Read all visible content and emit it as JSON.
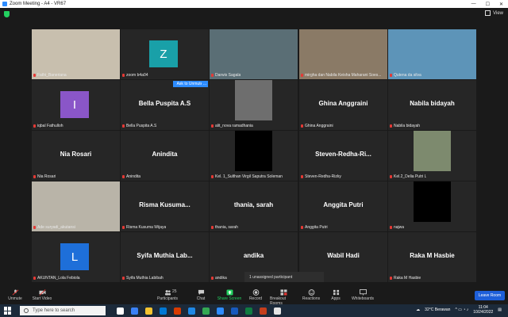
{
  "window": {
    "title": "Zoom Meeting - A4 - VR67"
  },
  "view_button": {
    "label": "View"
  },
  "participants": [
    {
      "id": "p1",
      "label": "Fathi_Baneriana",
      "type": "video",
      "bg": "#c8bfae"
    },
    {
      "id": "p2",
      "label": "zoom b4a04",
      "type": "avatar",
      "letter": "Z",
      "color": "#19a0a8"
    },
    {
      "id": "p3",
      "label": "Darwis Sagala",
      "type": "video",
      "bg": "#5a6e75",
      "active": true
    },
    {
      "id": "p4",
      "label": "mirgha dan Nabila Keisha Maharani Soes...",
      "type": "video",
      "bg": "#8a7a66"
    },
    {
      "id": "p5",
      "label": "Qutena da silva",
      "type": "video",
      "bg": "#5d94b8"
    },
    {
      "id": "p6",
      "label": "iqbal Fathulloh",
      "type": "avatar",
      "letter": "I",
      "color": "#8a56c8"
    },
    {
      "id": "p7",
      "label": "Bella Puspita A.S",
      "type": "text",
      "big": "Bella Puspita A.S"
    },
    {
      "id": "p8",
      "label": "alit_nova ramadhania",
      "type": "video",
      "bg": "#6e6e6e",
      "small": true
    },
    {
      "id": "p9",
      "label": "Ghina Anggraini",
      "type": "text",
      "big": "Ghina Anggraini"
    },
    {
      "id": "p10",
      "label": "Nabila bidayah",
      "type": "text",
      "big": "Nabila bidayah"
    },
    {
      "id": "p11",
      "label": "Nia Rosari",
      "type": "text",
      "big": "Nia Rosari"
    },
    {
      "id": "p12",
      "label": "Anindita",
      "type": "text",
      "big": "Anindita"
    },
    {
      "id": "p13",
      "label": "Kel. 1_Sulthan Virgil Saputra Soleman",
      "type": "video",
      "bg": "#000000",
      "small": true
    },
    {
      "id": "p14",
      "label": "Steven-Redha-Rizky",
      "type": "text",
      "big": "Steven-Redha-Ri..."
    },
    {
      "id": "p15",
      "label": "Kel.2_Delia Putri L",
      "type": "video",
      "bg": "#7d8a6e",
      "small": true
    },
    {
      "id": "p16",
      "label": "Ade suryadi_akutansi",
      "type": "video",
      "bg": "#b9b4a8"
    },
    {
      "id": "p17",
      "label": "Risma Kusuma Wijaya",
      "type": "text",
      "big": "Risma Kusuma..."
    },
    {
      "id": "p18",
      "label": "thania, sarah",
      "type": "text",
      "big": "thania, sarah"
    },
    {
      "id": "p19",
      "label": "Anggita Putri",
      "type": "text",
      "big": "Anggita Putri"
    },
    {
      "id": "p20",
      "label": "najwa",
      "type": "video",
      "bg": "#000000",
      "small": true
    },
    {
      "id": "p21",
      "label": "AKUNTAN_Lola Febiola",
      "type": "avatar",
      "letter": "L",
      "color": "#1e6fd9"
    },
    {
      "id": "p22",
      "label": "Syifa Muthia Labibah",
      "type": "text",
      "big": "Syifa Muthia Lab..."
    },
    {
      "id": "p23",
      "label": "andika",
      "type": "text",
      "big": "andika"
    },
    {
      "id": "p24",
      "label": "",
      "type": "text",
      "big": "Wabil Hadi"
    },
    {
      "id": "p25",
      "label": "Raka M Hasbie",
      "type": "text",
      "big": "Raka M Hasbie"
    }
  ],
  "ask_to_unmute": {
    "label": "Ask to Unmute",
    "more": "..."
  },
  "unassigned": {
    "label": "1 unassigned participant"
  },
  "toolbar": {
    "unmute": "Unmute",
    "start_video": "Start Video",
    "participants": "Participants",
    "participants_count": "25",
    "chat": "Chat",
    "share_screen": "Share Screen",
    "record": "Record",
    "breakout_rooms": "Breakout Rooms",
    "reactions": "Reactions",
    "apps": "Apps",
    "whiteboards": "Whiteboards",
    "leave": "Leave Room"
  },
  "taskbar": {
    "search_placeholder": "Type here to search",
    "weather": "32°C  Berawan",
    "time": "11:04",
    "date": "10/24/2022"
  }
}
